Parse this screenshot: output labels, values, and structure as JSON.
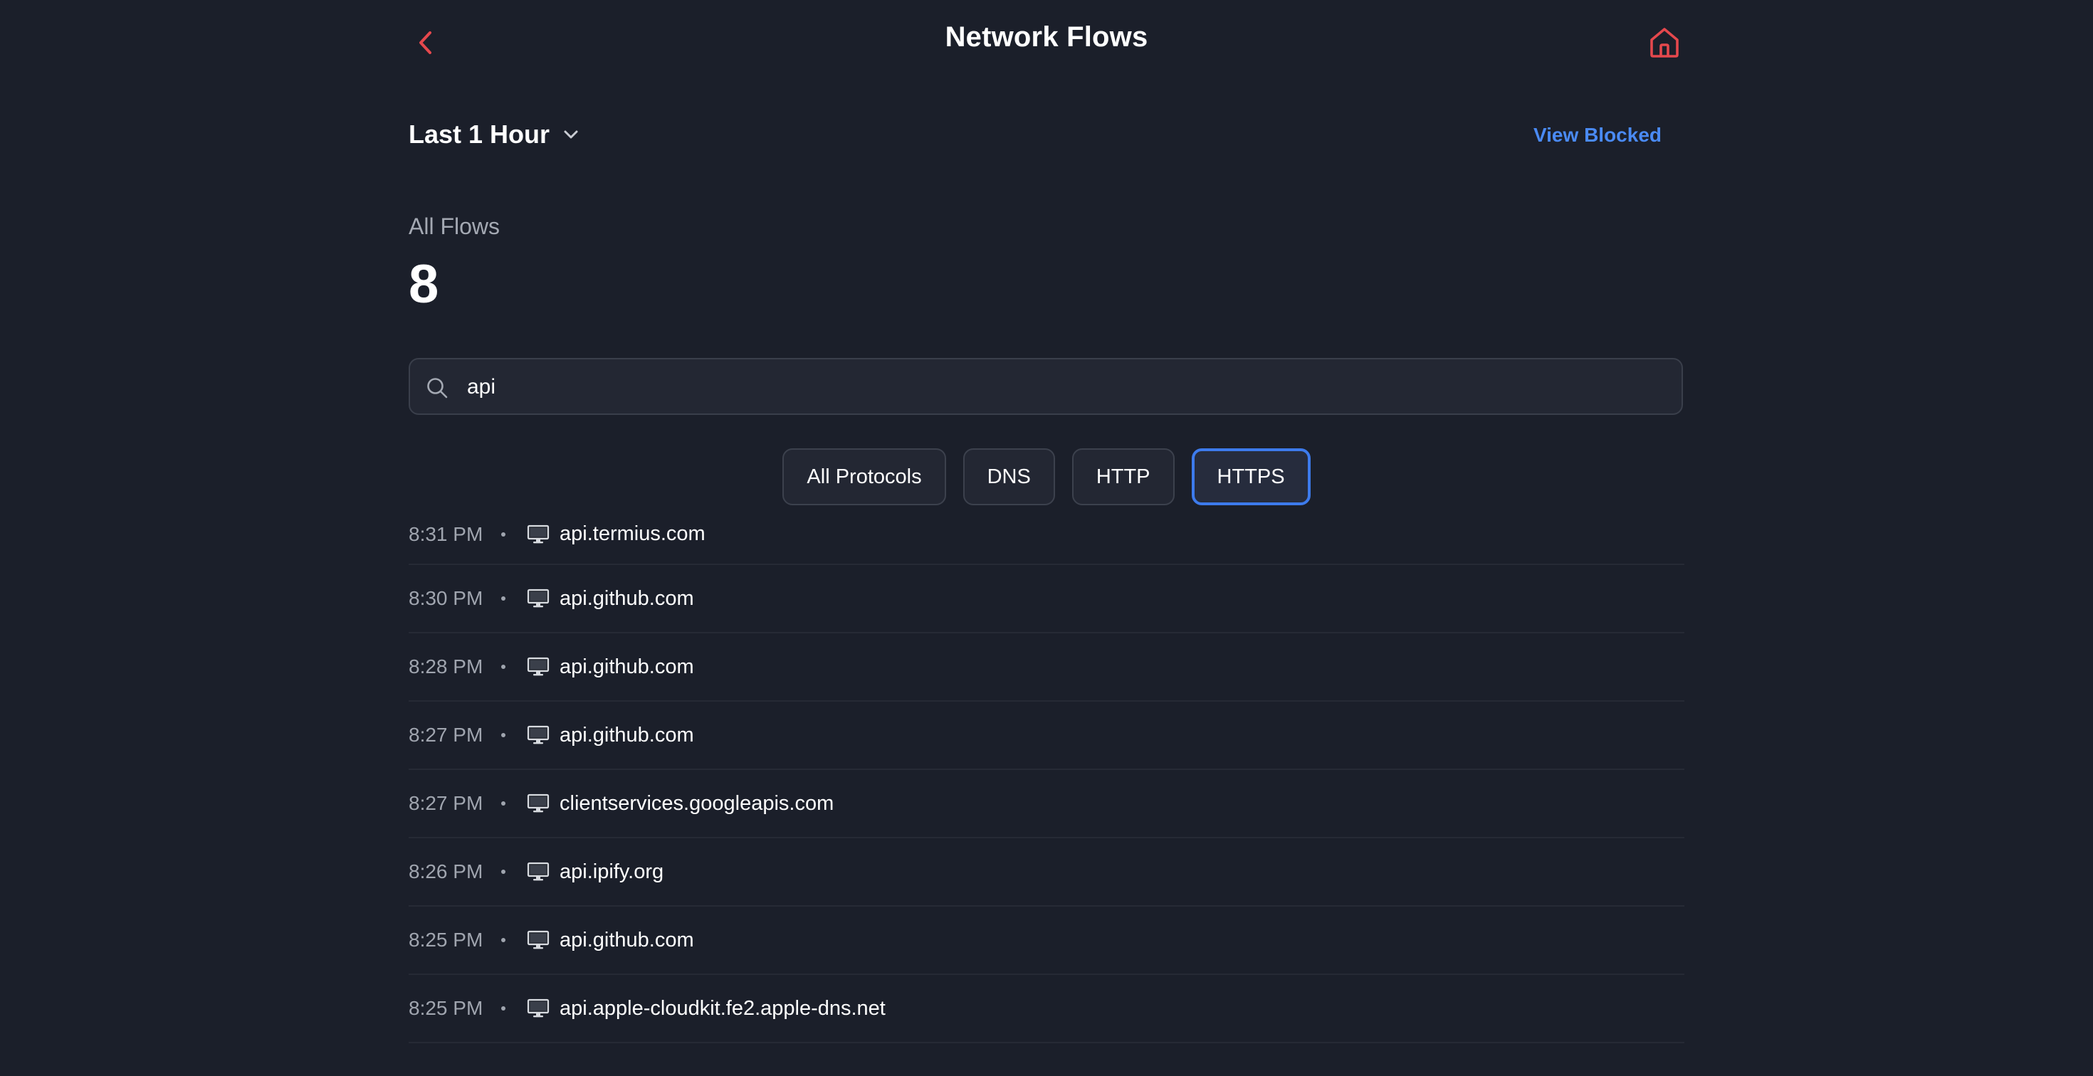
{
  "header": {
    "title": "Network Flows",
    "back_icon": "chevron-left-icon",
    "home_icon": "home-icon",
    "accent_color": "#e5484d"
  },
  "range": {
    "label": "Last 1 Hour",
    "chevron_icon": "chevron-down-icon",
    "view_blocked_label": "View Blocked",
    "link_color": "#4a8af4"
  },
  "summary": {
    "label": "All Flows",
    "count": "8"
  },
  "search": {
    "value": "api",
    "icon": "search-icon"
  },
  "filters": {
    "items": [
      {
        "label": "All Protocols",
        "active": false
      },
      {
        "label": "DNS",
        "active": false
      },
      {
        "label": "HTTP",
        "active": false
      },
      {
        "label": "HTTPS",
        "active": true
      }
    ],
    "active_color": "#3d7bec"
  },
  "flows": [
    {
      "time": "8:31 PM",
      "host": "api.termius.com",
      "icon": "computer-icon"
    },
    {
      "time": "8:30 PM",
      "host": "api.github.com",
      "icon": "computer-icon"
    },
    {
      "time": "8:28 PM",
      "host": "api.github.com",
      "icon": "computer-icon"
    },
    {
      "time": "8:27 PM",
      "host": "api.github.com",
      "icon": "computer-icon"
    },
    {
      "time": "8:27 PM",
      "host": "clientservices.googleapis.com",
      "icon": "computer-icon"
    },
    {
      "time": "8:26 PM",
      "host": "api.ipify.org",
      "icon": "computer-icon"
    },
    {
      "time": "8:25 PM",
      "host": "api.github.com",
      "icon": "computer-icon"
    },
    {
      "time": "8:25 PM",
      "host": "api.apple-cloudkit.fe2.apple-dns.net",
      "icon": "computer-icon"
    }
  ]
}
